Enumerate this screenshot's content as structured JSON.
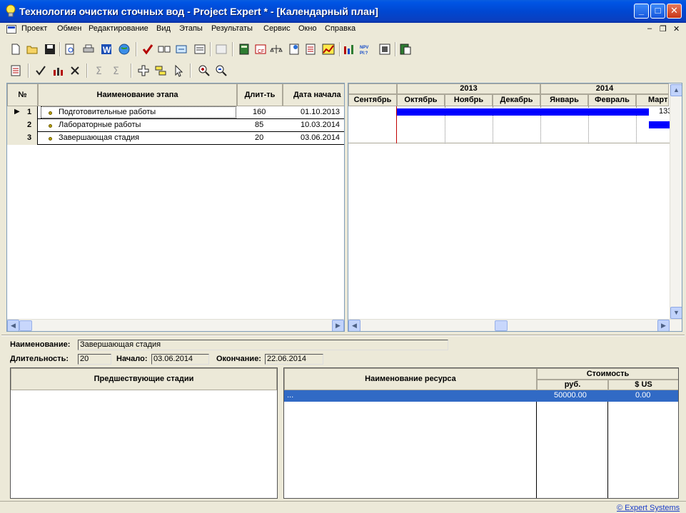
{
  "window": {
    "title": "Технология очистки сточных вод - Project Expert * - [Календарный план]"
  },
  "menu": [
    "Проект",
    "Обмен",
    "Редактирование",
    "Вид",
    "Этапы",
    "Результаты",
    "Сервис",
    "Окно",
    "Справка"
  ],
  "stages_table": {
    "headers": [
      "№",
      "Наименование этапа",
      "Длит-ть",
      "Дата начала"
    ],
    "rows": [
      {
        "num": "1",
        "name": "Подготовительные работы",
        "duration": "160",
        "start": "01.10.2013"
      },
      {
        "num": "2",
        "name": "Лабораторные работы",
        "duration": "85",
        "start": "10.03.2014"
      },
      {
        "num": "3",
        "name": "Завершающая стадия",
        "duration": "20",
        "start": "03.06.2014"
      }
    ]
  },
  "gantt": {
    "years": [
      "2013",
      "2014"
    ],
    "months": [
      "Сентябрь",
      "Октябрь",
      "Ноябрь",
      "Декабрь",
      "Январь",
      "Февраль",
      "Март"
    ],
    "bar_label": "133",
    "bar_color": "#0000ff"
  },
  "details": {
    "name_label": "Наименование:",
    "name_value": "Завершающая стадия",
    "duration_label": "Длительность:",
    "duration_value": "20",
    "start_label": "Начало:",
    "start_value": "03.06.2014",
    "end_label": "Окончание:",
    "end_value": "22.06.2014"
  },
  "predecessors": {
    "header": "Предшествующие стадии"
  },
  "resources": {
    "name_header": "Наименование ресурса",
    "cost_header": "Стоимость",
    "rub_header": "руб.",
    "usd_header": "$ US",
    "rows": [
      {
        "name": "...",
        "rub": "50000.00",
        "usd": "0.00"
      }
    ],
    "selection_color": "#316ac5"
  },
  "status": {
    "copyright": "© Expert Systems"
  }
}
